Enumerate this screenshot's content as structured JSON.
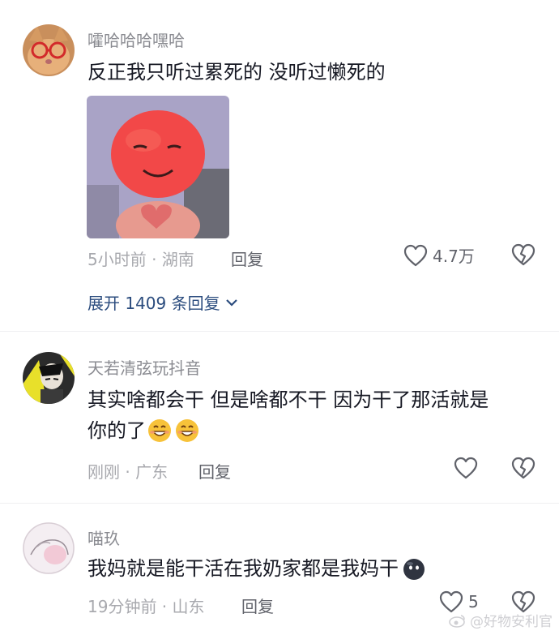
{
  "comments": [
    {
      "username": "嚯哈哈哈嘿哈",
      "text": "反正我只听过累死的 没听过懒死的",
      "time_location": "5小时前 · 湖南",
      "reply_label": "回复",
      "like_count": "4.7万",
      "expand_label": "展开 1409 条回复"
    },
    {
      "username": "天若清弦玩抖音",
      "text_line1": "其实啥都会干 但是啥都不干 因为干了那活就是",
      "text_line2": "你的了",
      "time_location": "刚刚 · 广东",
      "reply_label": "回复",
      "like_count": ""
    },
    {
      "username": "喵玖",
      "text": "我妈就是能干活在我奶家都是我妈干",
      "time_location": "19分钟前 · 山东",
      "reply_label": "回复",
      "like_count": "5"
    }
  ],
  "watermark": "@好物安利官",
  "colors": {
    "text": "#161823",
    "username": "#8a8b91",
    "meta": "#a8a9ae",
    "link": "#2b4c7e",
    "divider": "#efeff1"
  },
  "icons": [
    "heart-icon",
    "broken-heart-icon",
    "chevron-down-icon",
    "grin-emoji",
    "dark-blob-emoji",
    "weibo-logo"
  ]
}
